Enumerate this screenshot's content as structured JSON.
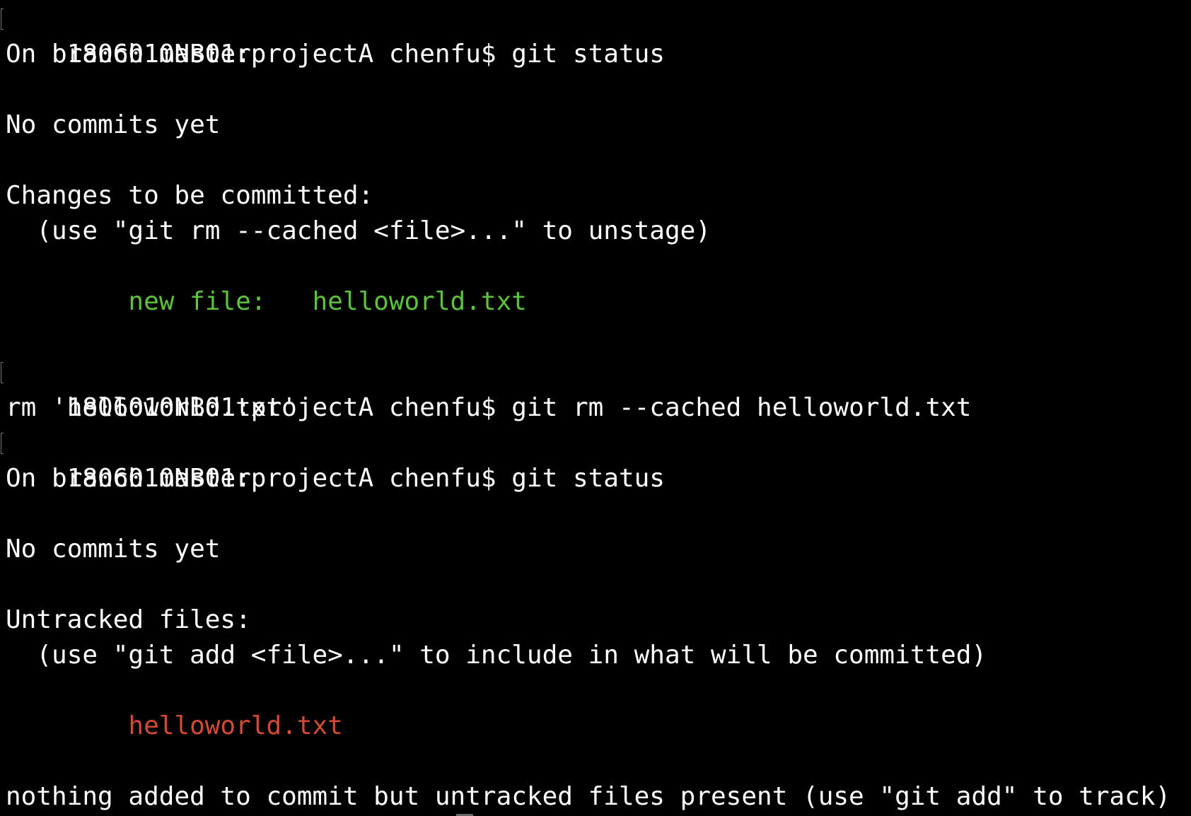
{
  "terminal": {
    "colors": {
      "background": "#000000",
      "text": "#ffffff",
      "staged": "#5cc33a",
      "untracked": "#d44a35"
    },
    "lines": {
      "l1": "1806010NB01:projectA chenfu$ git status",
      "l2": "On branch master",
      "l4": "No commits yet",
      "l6": "Changes to be committed:",
      "l7": "  (use \"git rm --cached <file>...\" to unstage)",
      "l9_prefix": "        ",
      "l9": "new file:   helloworld.txt",
      "l11": "1806010NB01:projectA chenfu$ git rm --cached helloworld.txt",
      "l12": "rm 'helloworld.txt'",
      "l13": "1806010NB01:projectA chenfu$ git status",
      "l14": "On branch master",
      "l16": "No commits yet",
      "l18": "Untracked files:",
      "l19": "  (use \"git add <file>...\" to include in what will be committed)",
      "l21_prefix": "        ",
      "l21": "helloworld.txt",
      "l23": "nothing added to commit but untracked files present (use \"git add\" to track)"
    }
  }
}
